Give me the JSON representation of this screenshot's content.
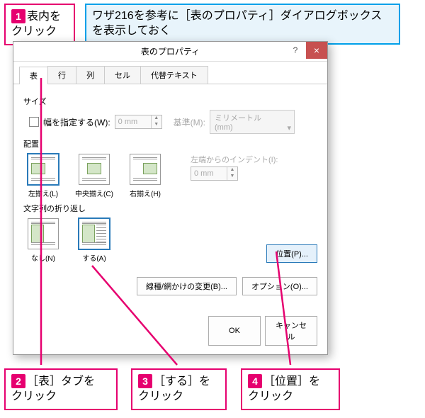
{
  "callouts": {
    "c1_num": "1",
    "c1_text": "表内を\nクリック",
    "info_text": "ワザ216を参考に［表のプロパティ］ダイアログボックスを表示しておく",
    "c2_num": "2",
    "c2_text": "［表］タブを\nクリック",
    "c3_num": "3",
    "c3_text": "［する］を\nクリック",
    "c4_num": "4",
    "c4_text": "［位置］を\nクリック"
  },
  "dialog": {
    "title": "表のプロパティ",
    "help": "?",
    "close": "×",
    "tabs": [
      "表",
      "行",
      "列",
      "セル",
      "代替テキスト"
    ],
    "size": {
      "label": "サイズ",
      "width_chk": "幅を指定する(W):",
      "width_val": "0 mm",
      "basis_label": "基準(M):",
      "basis_val": "ミリメートル (mm)"
    },
    "align": {
      "label": "配置",
      "opts": [
        "左揃え(L)",
        "中央揃え(C)",
        "右揃え(H)"
      ],
      "indent_label": "左端からのインデント(I):",
      "indent_val": "0 mm"
    },
    "wrap": {
      "label": "文字列の折り返し",
      "opts": [
        "なし(N)",
        "する(A)"
      ],
      "pos_btn": "位置(P)..."
    },
    "bottom": {
      "borders": "線種/網かけの変更(B)...",
      "options": "オプション(O)..."
    },
    "ok": "OK",
    "cancel": "キャンセル"
  }
}
